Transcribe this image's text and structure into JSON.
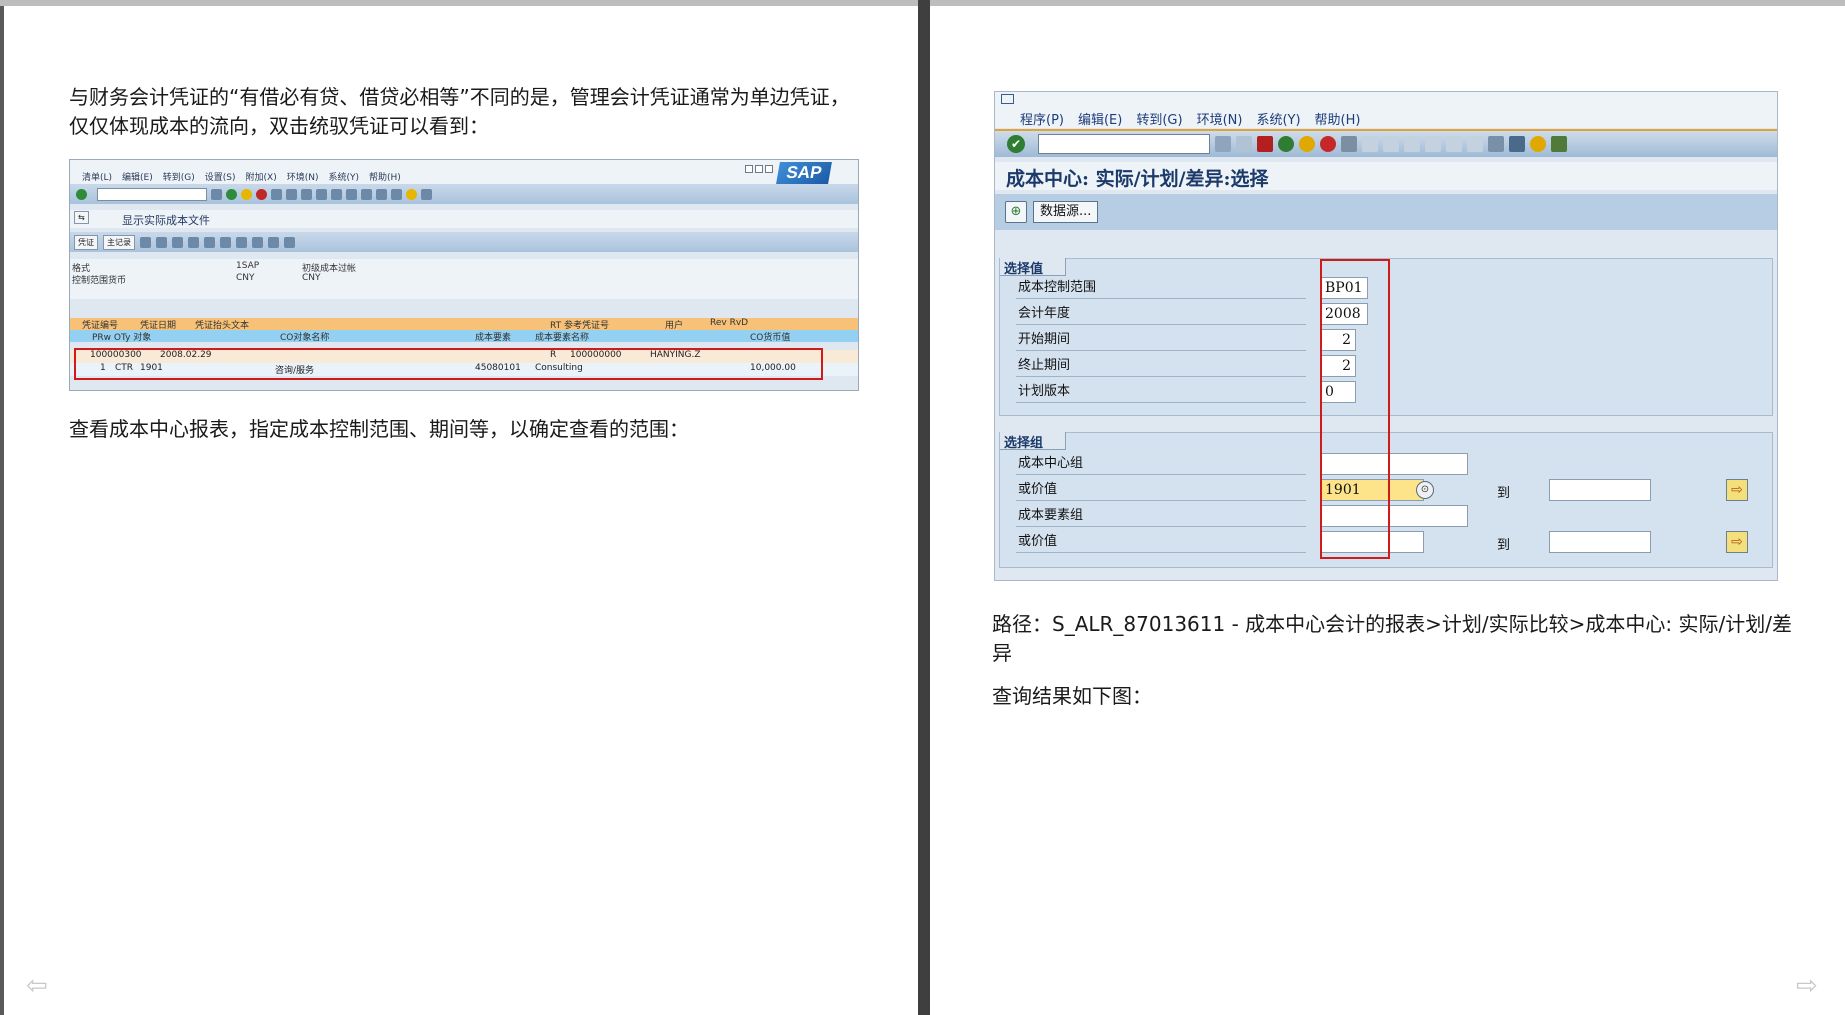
{
  "left_page": {
    "paragraph1": "与财务会计凭证的“有借必有贷、借贷必相等”不同的是，管理会计凭证通常为单边凭证，仅仅体现成本的流向，双击统驭凭证可以看到：",
    "paragraph2": "查看成本中心报表，指定成本控制范围、期间等，以确定查看的范围：",
    "screenshot": {
      "menu": [
        "清单(L)",
        "编辑(E)",
        "转到(G)",
        "设置(S)",
        "附加(X)",
        "环境(N)",
        "系统(Y)",
        "帮助(H)"
      ],
      "logo": "SAP",
      "title": "显示实际成本文件",
      "buttons": [
        "凭证",
        "主记录"
      ],
      "info": [
        {
          "label": "格式",
          "code": "1SAP",
          "desc": "初级成本过帐"
        },
        {
          "label": "控制范围货币",
          "code": "CNY",
          "desc": "CNY"
        }
      ],
      "header1": [
        "凭证编号",
        "凭证日期",
        "凭证抬头文本",
        "RT 参考凭证号",
        "用户",
        "Rev RvD"
      ],
      "header2": [
        "PRw OTy 对象",
        "CO对象名称",
        "成本要素",
        "成本要素名称",
        "CO货币值"
      ],
      "row1": {
        "doc": "100000300",
        "date": "2008.02.29",
        "rt": "R",
        "ref": "100000000",
        "user": "HANYING.Z"
      },
      "row2": {
        "item": "1",
        "oty": "CTR",
        "obj": "1901",
        "name": "咨询/服务",
        "ce": "45080101",
        "ce_name": "Consulting",
        "value": "10,000.00"
      }
    }
  },
  "right_page": {
    "screenshot": {
      "menu": [
        "程序(P)",
        "编辑(E)",
        "转到(G)",
        "环境(N)",
        "系统(Y)",
        "帮助(H)"
      ],
      "title": "成本中心: 实际/计划/差异:选择",
      "data_source_button": "数据源...",
      "group1": {
        "title": "选择值",
        "fields": [
          {
            "label": "成本控制范围",
            "value": "BP01"
          },
          {
            "label": "会计年度",
            "value": "2008"
          },
          {
            "label": "开始期间",
            "value": "2"
          },
          {
            "label": "终止期间",
            "value": "2"
          },
          {
            "label": "计划版本",
            "value": "0"
          }
        ]
      },
      "group2": {
        "title": "选择组",
        "fields": [
          {
            "label": "成本中心组",
            "value": ""
          },
          {
            "label": "或价值",
            "value": "1901"
          },
          {
            "label": "成本要素组",
            "value": ""
          },
          {
            "label": "或价值",
            "value": ""
          }
        ],
        "to_label": "到"
      }
    },
    "paragraph_path": "路径：S_ALR_87013611 - 成本中心会计的报表>计划/实际比较>成本中心: 实际/计划/差异",
    "paragraph_result": "查询结果如下图："
  },
  "nav": {
    "prev_icon": "arrow-left-icon",
    "next_icon": "arrow-right-icon"
  },
  "colors": {
    "highlight_red": "#d11b1b",
    "sap_toolbar_blue": "#9fbad6",
    "field_highlight": "#fde48a"
  }
}
